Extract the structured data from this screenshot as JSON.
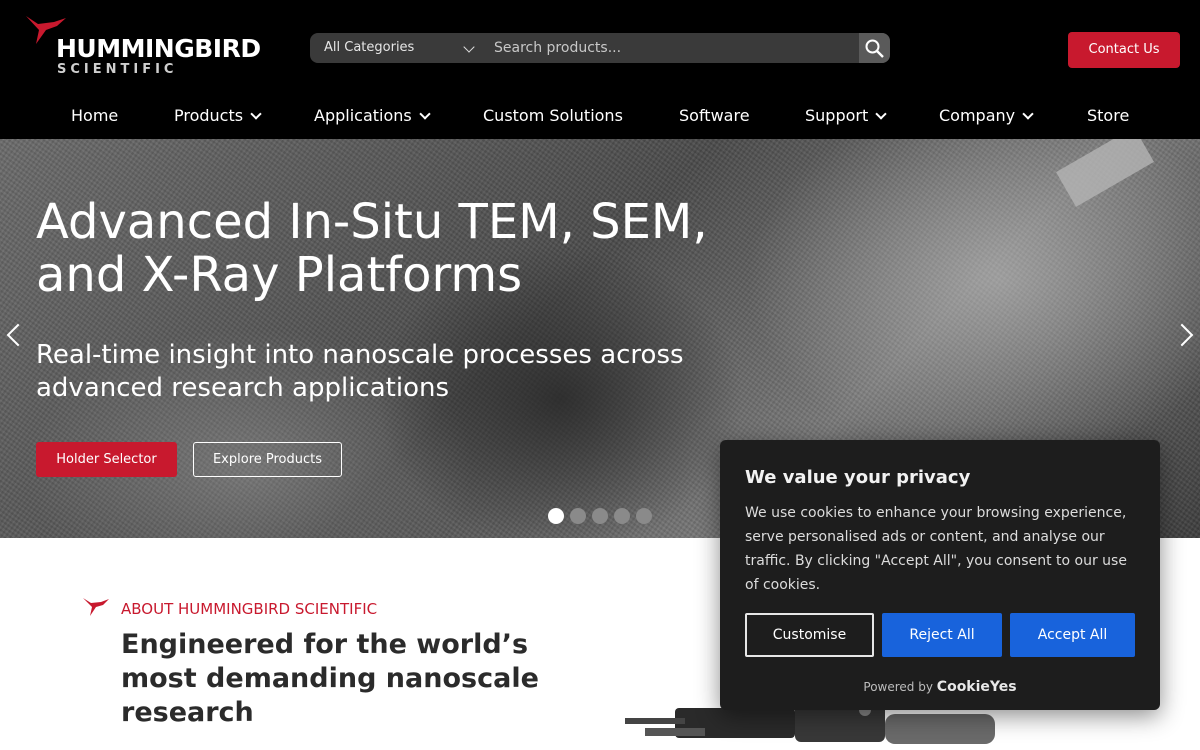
{
  "header": {
    "logo": {
      "name": "HUMMINGBIRD",
      "sub": "SCIENTIFIC"
    },
    "search": {
      "category": "All Categories",
      "placeholder": "Search products..."
    },
    "contact_label": "Contact Us",
    "nav": [
      {
        "label": "Home",
        "dropdown": false
      },
      {
        "label": "Products",
        "dropdown": true
      },
      {
        "label": "Applications",
        "dropdown": true
      },
      {
        "label": "Custom Solutions",
        "dropdown": false
      },
      {
        "label": "Software",
        "dropdown": false
      },
      {
        "label": "Support",
        "dropdown": true
      },
      {
        "label": "Company",
        "dropdown": true
      },
      {
        "label": "Store",
        "dropdown": false
      }
    ]
  },
  "hero": {
    "title": "Advanced In-Situ TEM, SEM, and X-Ray Platforms",
    "subtitle": "Real-time insight into nanoscale processes across advanced research applications",
    "primary_button": "Holder Selector",
    "secondary_button": "Explore Products",
    "slides_total": 5,
    "active_slide": 1
  },
  "about": {
    "kicker": "ABOUT HUMMINGBIRD SCIENTIFIC",
    "title": "Engineered for the world’s most demanding nanoscale research"
  },
  "cookie": {
    "title": "We value your privacy",
    "text": "We use cookies to enhance your browsing experience, serve personalised ads or content, and analyse our traffic. By clicking \"Accept All\", you consent to our use of cookies.",
    "customise": "Customise",
    "reject": "Reject All",
    "accept": "Accept All",
    "powered_by": "Powered by",
    "brand": "CookieYes"
  },
  "colors": {
    "brand_red": "#c8192e",
    "cookie_blue": "#1863dc"
  }
}
